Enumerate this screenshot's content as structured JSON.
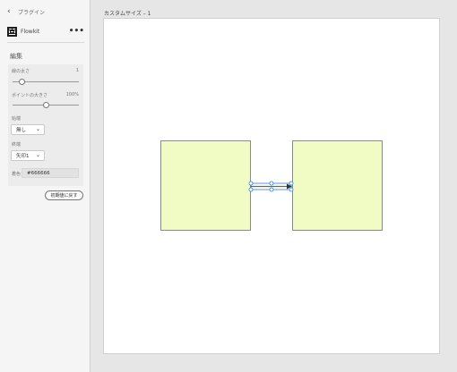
{
  "sidebar": {
    "back_label": "プラグイン",
    "plugin_name": "Flowkit",
    "plugin_menu": "•••",
    "section_title": "編集",
    "line_thickness": {
      "label": "線の太さ",
      "value": "1",
      "level": 0.12
    },
    "point_size": {
      "label": "ポイントの大きさ",
      "value": "100%",
      "level": 0.5
    },
    "start": {
      "label": "始端",
      "selected": "無し"
    },
    "end": {
      "label": "終端",
      "selected": "矢印1"
    },
    "color": {
      "label": "着色",
      "value": "#666666"
    },
    "reset_label": "初期値に戻す"
  },
  "canvas": {
    "artboard_title": "カスタムサイズ – 1",
    "shape_fill": "#f0fcc3",
    "connector_color": "#666666",
    "selection_color": "#2680eb"
  }
}
